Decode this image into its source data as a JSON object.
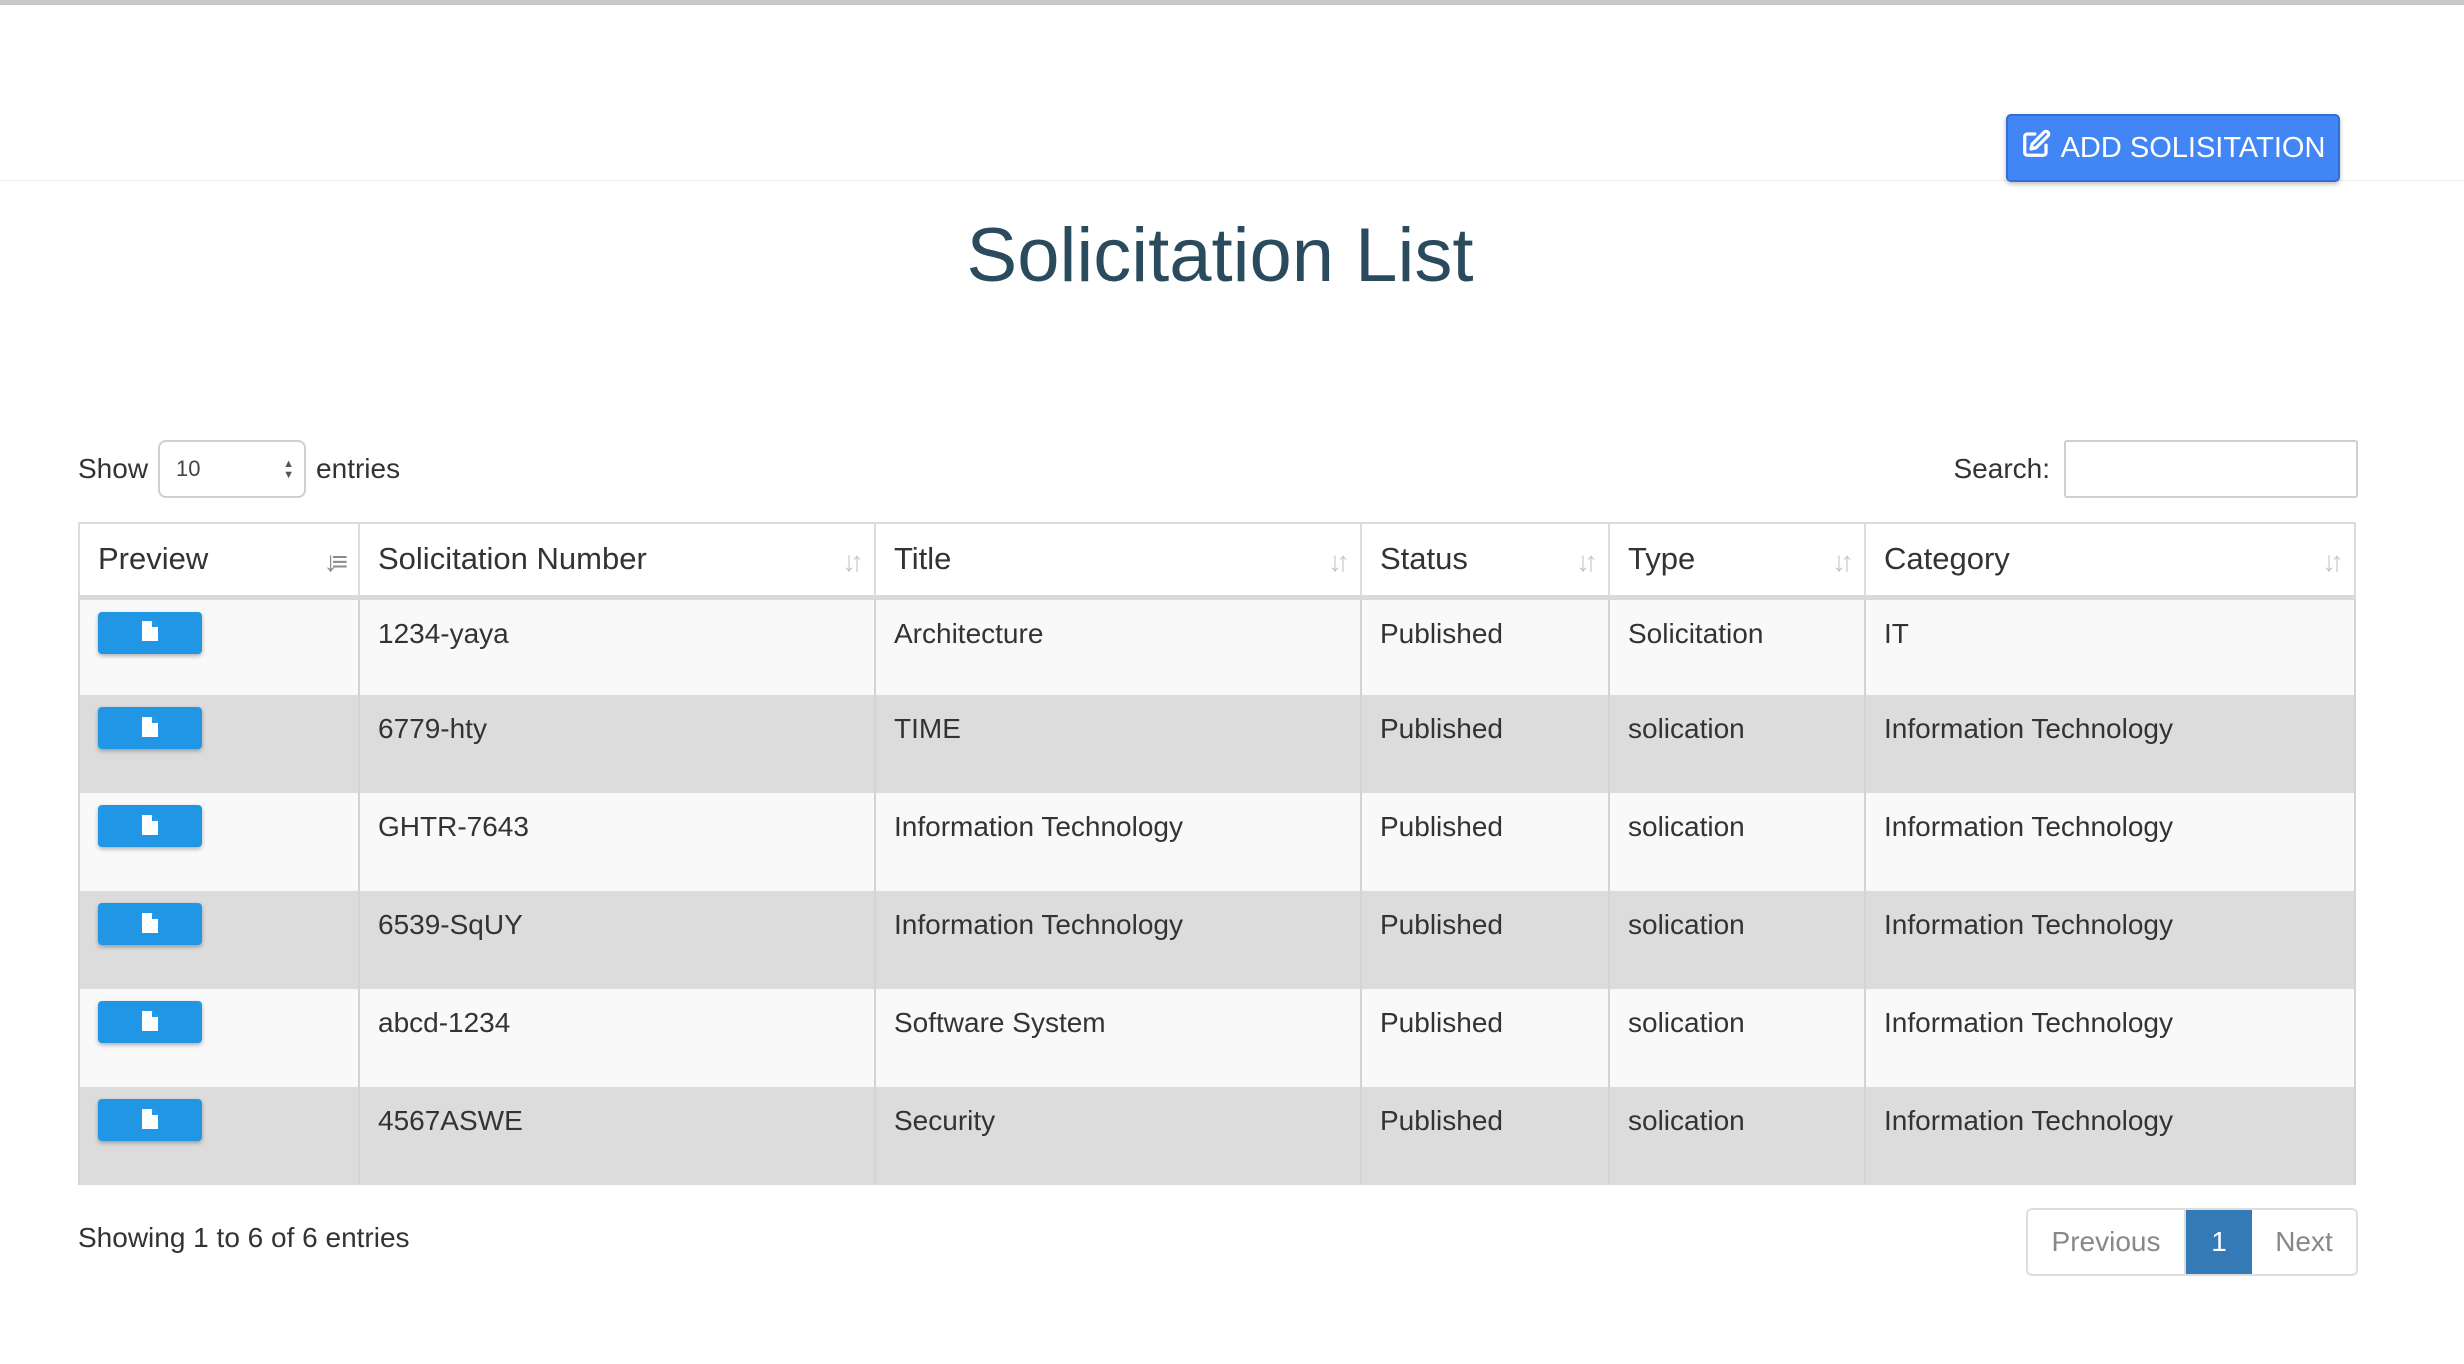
{
  "toolbar": {
    "add_label": "ADD SOLISITATION",
    "add_icon": "edit-square-icon"
  },
  "page": {
    "title": "Solicitation List"
  },
  "length": {
    "show_label": "Show",
    "value": "10",
    "entries_label": "entries"
  },
  "search": {
    "label": "Search:",
    "value": ""
  },
  "table": {
    "columns": [
      "Preview",
      "Solicitation Number",
      "Title",
      "Status",
      "Type",
      "Category"
    ],
    "sorted_column": "Preview",
    "rows": [
      {
        "number": "1234-yaya",
        "title": "Architecture",
        "status": "Published",
        "type": "Solicitation",
        "category": "IT"
      },
      {
        "number": "6779-hty",
        "title": "TIME",
        "status": "Published",
        "type": "solication",
        "category": "Information Technology"
      },
      {
        "number": "GHTR-7643",
        "title": "Information Technology",
        "status": "Published",
        "type": "solication",
        "category": "Information Technology"
      },
      {
        "number": "6539-SqUY",
        "title": "Information Technology",
        "status": "Published",
        "type": "solication",
        "category": "Information Technology"
      },
      {
        "number": "abcd-1234",
        "title": "Software System",
        "status": "Published",
        "type": "solication",
        "category": "Information Technology"
      },
      {
        "number": "4567ASWE",
        "title": "Security",
        "status": "Published",
        "type": "solication",
        "category": "Information Technology"
      }
    ]
  },
  "info": "Showing 1 to 6 of 6 entries",
  "pagination": {
    "previous": "Previous",
    "current": "1",
    "next": "Next"
  },
  "colors": {
    "accent": "#4285f4",
    "status_link": "#2fa9e0",
    "page_active": "#337ab7",
    "title": "#2a4b5e"
  }
}
